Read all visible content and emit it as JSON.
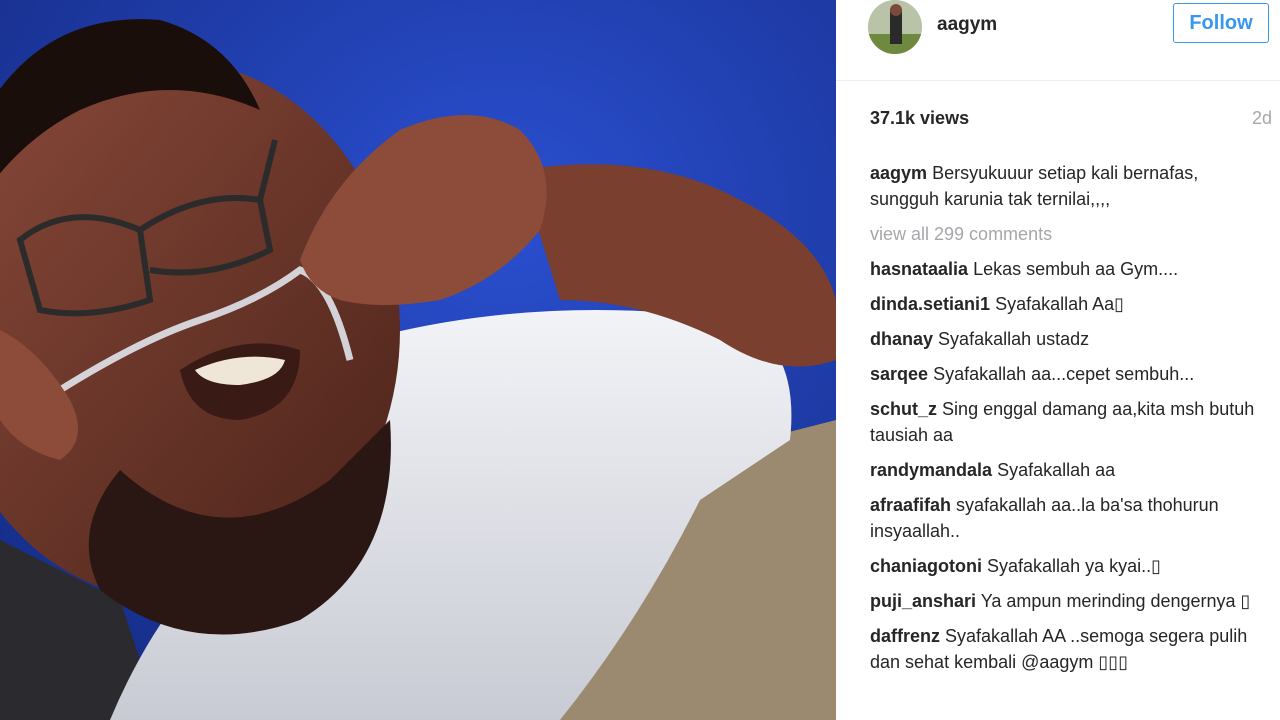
{
  "post": {
    "username": "aagym",
    "follow_label": "Follow",
    "views": "37.1k views",
    "age": "2d",
    "caption": {
      "user": "aagym",
      "text": "Bersyukuuur setiap kali bernafas, sungguh karunia tak ternilai,,,,"
    },
    "view_all": "view all 299 comments",
    "comments": [
      {
        "user": "hasnataalia",
        "text": "Lekas sembuh aa Gym...."
      },
      {
        "user": "dinda.setiani1",
        "text": "Syafakallah Aa▯"
      },
      {
        "user": "dhanay",
        "text": "Syafakallah ustadz"
      },
      {
        "user": "sarqee",
        "text": "Syafakallah aa...cepet sembuh..."
      },
      {
        "user": "schut_z",
        "text": "Sing enggal damang aa,kita msh butuh tausiah aa"
      },
      {
        "user": "randymandala",
        "text": "Syafakallah aa"
      },
      {
        "user": "afraafifah",
        "text": "syafakallah aa..la ba'sa thohurun insyaallah.."
      },
      {
        "user": "chaniagotoni",
        "text": "Syafakallah ya kyai..▯"
      },
      {
        "user": "puji_anshari",
        "text": "Ya ampun merinding dengernya ▯"
      },
      {
        "user": "daffrenz",
        "text": "Syafakallah AA ..semoga segera pulih dan sehat kembali @aagym ▯▯▯"
      }
    ]
  },
  "colors": {
    "accent": "#3897f0",
    "text": "#262626",
    "muted": "#a5a7aa",
    "photo_background": "#1f3fb8"
  }
}
